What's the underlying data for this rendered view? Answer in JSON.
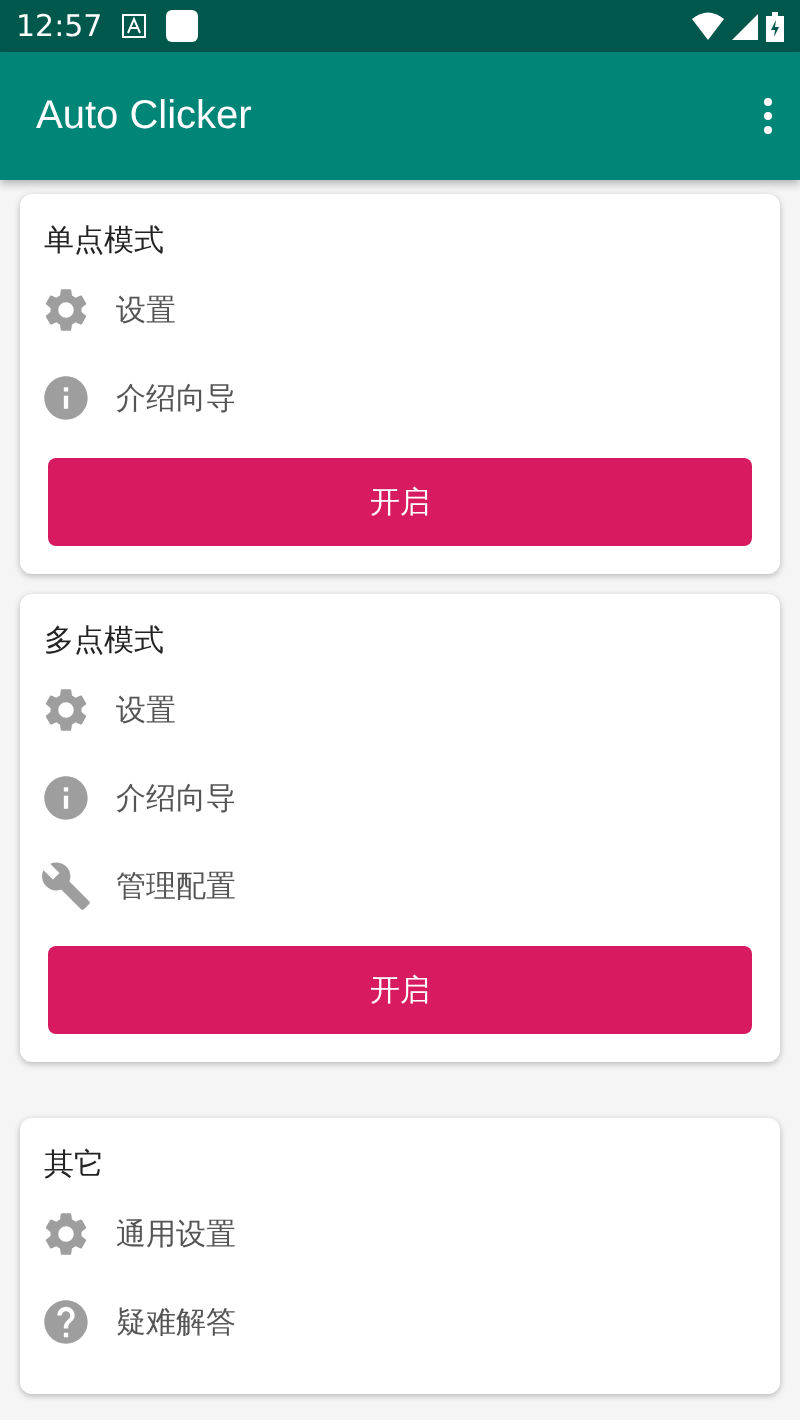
{
  "status_bar": {
    "time": "12:57"
  },
  "app_bar": {
    "title": "Auto Clicker"
  },
  "cards": [
    {
      "title": "单点模式",
      "items": [
        {
          "kind": "settings",
          "label": "设置"
        },
        {
          "kind": "info",
          "label": "介绍向导"
        }
      ],
      "button": "开启"
    },
    {
      "title": "多点模式",
      "items": [
        {
          "kind": "settings",
          "label": "设置"
        },
        {
          "kind": "info",
          "label": "介绍向导"
        },
        {
          "kind": "wrench",
          "label": "管理配置"
        }
      ],
      "button": "开启"
    },
    {
      "title": "其它",
      "items": [
        {
          "kind": "settings",
          "label": "通用设置"
        },
        {
          "kind": "help",
          "label": "疑难解答"
        }
      ]
    }
  ]
}
